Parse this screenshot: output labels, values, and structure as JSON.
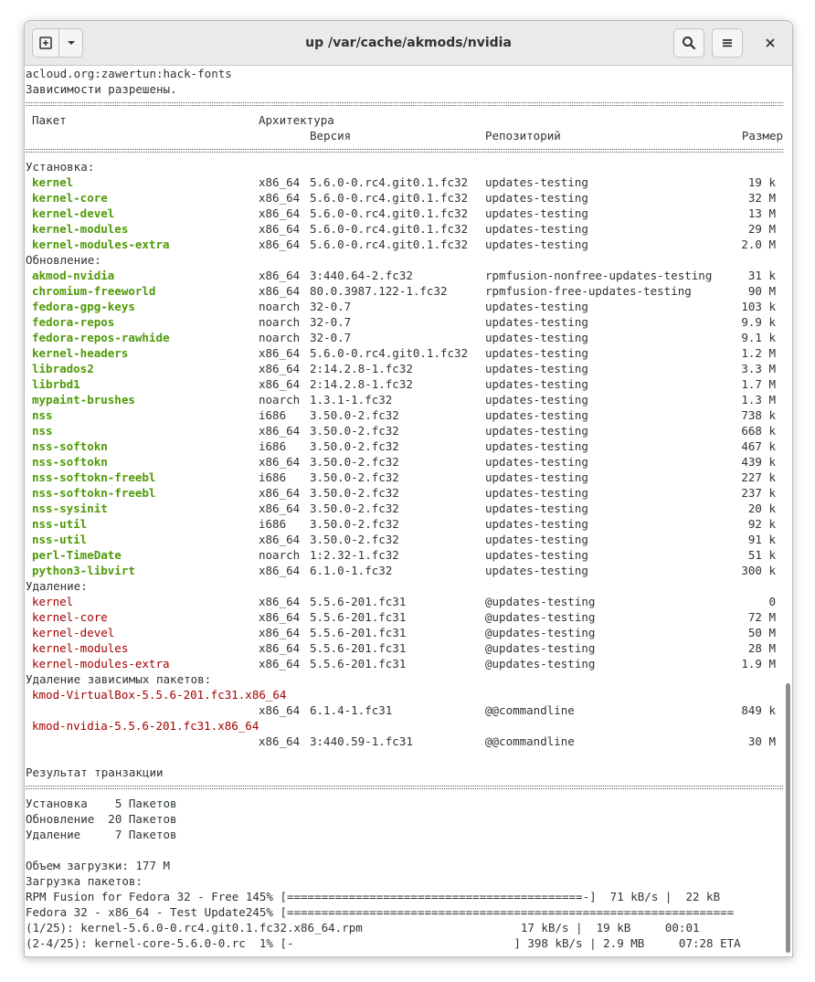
{
  "window": {
    "title": "up /var/cache/akmods/nvidia"
  },
  "header_lines": [
    "acloud.org:zawertun:hack-fonts",
    "Зависимости разрешены."
  ],
  "columns": {
    "package": "Пакет",
    "arch": "Архитектура",
    "version": "Версия",
    "repo": "Репозиторий",
    "size": "Размер"
  },
  "sections": [
    {
      "title": "Установка:",
      "color": "green",
      "rows": [
        {
          "name": "kernel",
          "arch": "x86_64",
          "version": "5.6.0-0.rc4.git0.1.fc32",
          "repo": "updates-testing",
          "size": "19 k"
        },
        {
          "name": "kernel-core",
          "arch": "x86_64",
          "version": "5.6.0-0.rc4.git0.1.fc32",
          "repo": "updates-testing",
          "size": "32 M"
        },
        {
          "name": "kernel-devel",
          "arch": "x86_64",
          "version": "5.6.0-0.rc4.git0.1.fc32",
          "repo": "updates-testing",
          "size": "13 M"
        },
        {
          "name": "kernel-modules",
          "arch": "x86_64",
          "version": "5.6.0-0.rc4.git0.1.fc32",
          "repo": "updates-testing",
          "size": "29 M"
        },
        {
          "name": "kernel-modules-extra",
          "arch": "x86_64",
          "version": "5.6.0-0.rc4.git0.1.fc32",
          "repo": "updates-testing",
          "size": "2.0 M"
        }
      ]
    },
    {
      "title": "Обновление:",
      "color": "green",
      "rows": [
        {
          "name": "akmod-nvidia",
          "arch": "x86_64",
          "version": "3:440.64-2.fc32",
          "repo": "rpmfusion-nonfree-updates-testing",
          "size": "31 k"
        },
        {
          "name": "chromium-freeworld",
          "arch": "x86_64",
          "version": "80.0.3987.122-1.fc32",
          "repo": "rpmfusion-free-updates-testing",
          "size": "90 M"
        },
        {
          "name": "fedora-gpg-keys",
          "arch": "noarch",
          "version": "32-0.7",
          "repo": "updates-testing",
          "size": "103 k"
        },
        {
          "name": "fedora-repos",
          "arch": "noarch",
          "version": "32-0.7",
          "repo": "updates-testing",
          "size": "9.9 k"
        },
        {
          "name": "fedora-repos-rawhide",
          "arch": "noarch",
          "version": "32-0.7",
          "repo": "updates-testing",
          "size": "9.1 k"
        },
        {
          "name": "kernel-headers",
          "arch": "x86_64",
          "version": "5.6.0-0.rc4.git0.1.fc32",
          "repo": "updates-testing",
          "size": "1.2 M"
        },
        {
          "name": "librados2",
          "arch": "x86_64",
          "version": "2:14.2.8-1.fc32",
          "repo": "updates-testing",
          "size": "3.3 M"
        },
        {
          "name": "librbd1",
          "arch": "x86_64",
          "version": "2:14.2.8-1.fc32",
          "repo": "updates-testing",
          "size": "1.7 M"
        },
        {
          "name": "mypaint-brushes",
          "arch": "noarch",
          "version": "1.3.1-1.fc32",
          "repo": "updates-testing",
          "size": "1.3 M"
        },
        {
          "name": "nss",
          "arch": "i686",
          "version": "3.50.0-2.fc32",
          "repo": "updates-testing",
          "size": "738 k"
        },
        {
          "name": "nss",
          "arch": "x86_64",
          "version": "3.50.0-2.fc32",
          "repo": "updates-testing",
          "size": "668 k"
        },
        {
          "name": "nss-softokn",
          "arch": "i686",
          "version": "3.50.0-2.fc32",
          "repo": "updates-testing",
          "size": "467 k"
        },
        {
          "name": "nss-softokn",
          "arch": "x86_64",
          "version": "3.50.0-2.fc32",
          "repo": "updates-testing",
          "size": "439 k"
        },
        {
          "name": "nss-softokn-freebl",
          "arch": "i686",
          "version": "3.50.0-2.fc32",
          "repo": "updates-testing",
          "size": "227 k"
        },
        {
          "name": "nss-softokn-freebl",
          "arch": "x86_64",
          "version": "3.50.0-2.fc32",
          "repo": "updates-testing",
          "size": "237 k"
        },
        {
          "name": "nss-sysinit",
          "arch": "x86_64",
          "version": "3.50.0-2.fc32",
          "repo": "updates-testing",
          "size": "20 k"
        },
        {
          "name": "nss-util",
          "arch": "i686",
          "version": "3.50.0-2.fc32",
          "repo": "updates-testing",
          "size": "92 k"
        },
        {
          "name": "nss-util",
          "arch": "x86_64",
          "version": "3.50.0-2.fc32",
          "repo": "updates-testing",
          "size": "91 k"
        },
        {
          "name": "perl-TimeDate",
          "arch": "noarch",
          "version": "1:2.32-1.fc32",
          "repo": "updates-testing",
          "size": "51 k"
        },
        {
          "name": "python3-libvirt",
          "arch": "x86_64",
          "version": "6.1.0-1.fc32",
          "repo": "updates-testing",
          "size": "300 k"
        }
      ]
    },
    {
      "title": "Удаление:",
      "color": "red",
      "rows": [
        {
          "name": "kernel",
          "arch": "x86_64",
          "version": "5.5.6-201.fc31",
          "repo": "@updates-testing",
          "size": "0"
        },
        {
          "name": "kernel-core",
          "arch": "x86_64",
          "version": "5.5.6-201.fc31",
          "repo": "@updates-testing",
          "size": "72 M"
        },
        {
          "name": "kernel-devel",
          "arch": "x86_64",
          "version": "5.5.6-201.fc31",
          "repo": "@updates-testing",
          "size": "50 M"
        },
        {
          "name": "kernel-modules",
          "arch": "x86_64",
          "version": "5.5.6-201.fc31",
          "repo": "@updates-testing",
          "size": "28 M"
        },
        {
          "name": "kernel-modules-extra",
          "arch": "x86_64",
          "version": "5.5.6-201.fc31",
          "repo": "@updates-testing",
          "size": "1.9 M"
        }
      ]
    },
    {
      "title": "Удаление зависимых пакетов:",
      "color": "red",
      "wrapped": true,
      "rows": [
        {
          "name": "kmod-VirtualBox-5.5.6-201.fc31.x86_64",
          "arch": "x86_64",
          "version": "6.1.4-1.fc31",
          "repo": "@@commandline",
          "size": "849 k"
        },
        {
          "name": "kmod-nvidia-5.5.6-201.fc31.x86_64",
          "arch": "x86_64",
          "version": "3:440.59-1.fc31",
          "repo": "@@commandline",
          "size": "30 M"
        }
      ]
    }
  ],
  "summary": {
    "title": "Результат транзакции",
    "lines": [
      "Установка    5 Пакетов",
      "Обновление  20 Пакетов",
      "Удаление     7 Пакетов"
    ],
    "download_size": "Объем загрузки: 177 М",
    "download_label": "Загрузка пакетов:"
  },
  "progress_lines": [
    "RPM Fusion for Fedora 32 - Free 145% [===========================================-]  71 kB/s |  22 kB",
    "Fedora 32 - x86_64 - Test Update245% [=================================================================",
    "(1/25): kernel-5.6.0-0.rc4.git0.1.fc32.x86_64.rpm                       17 kB/s |  19 kB     00:01",
    "(2-4/25): kernel-core-5.6.0-0.rc  1% [-                                ] 398 kB/s | 2.9 MB     07:28 ETA"
  ],
  "colors": {
    "green": "#4e9a06",
    "red": "#a40000",
    "text": "#2e3436",
    "headerbar": "#ebeae9"
  },
  "icons": {
    "new_tab": "new-tab-icon",
    "tab_menu": "chevron-down-icon",
    "search": "search-icon",
    "menu": "hamburger-menu-icon",
    "close": "close-icon"
  }
}
